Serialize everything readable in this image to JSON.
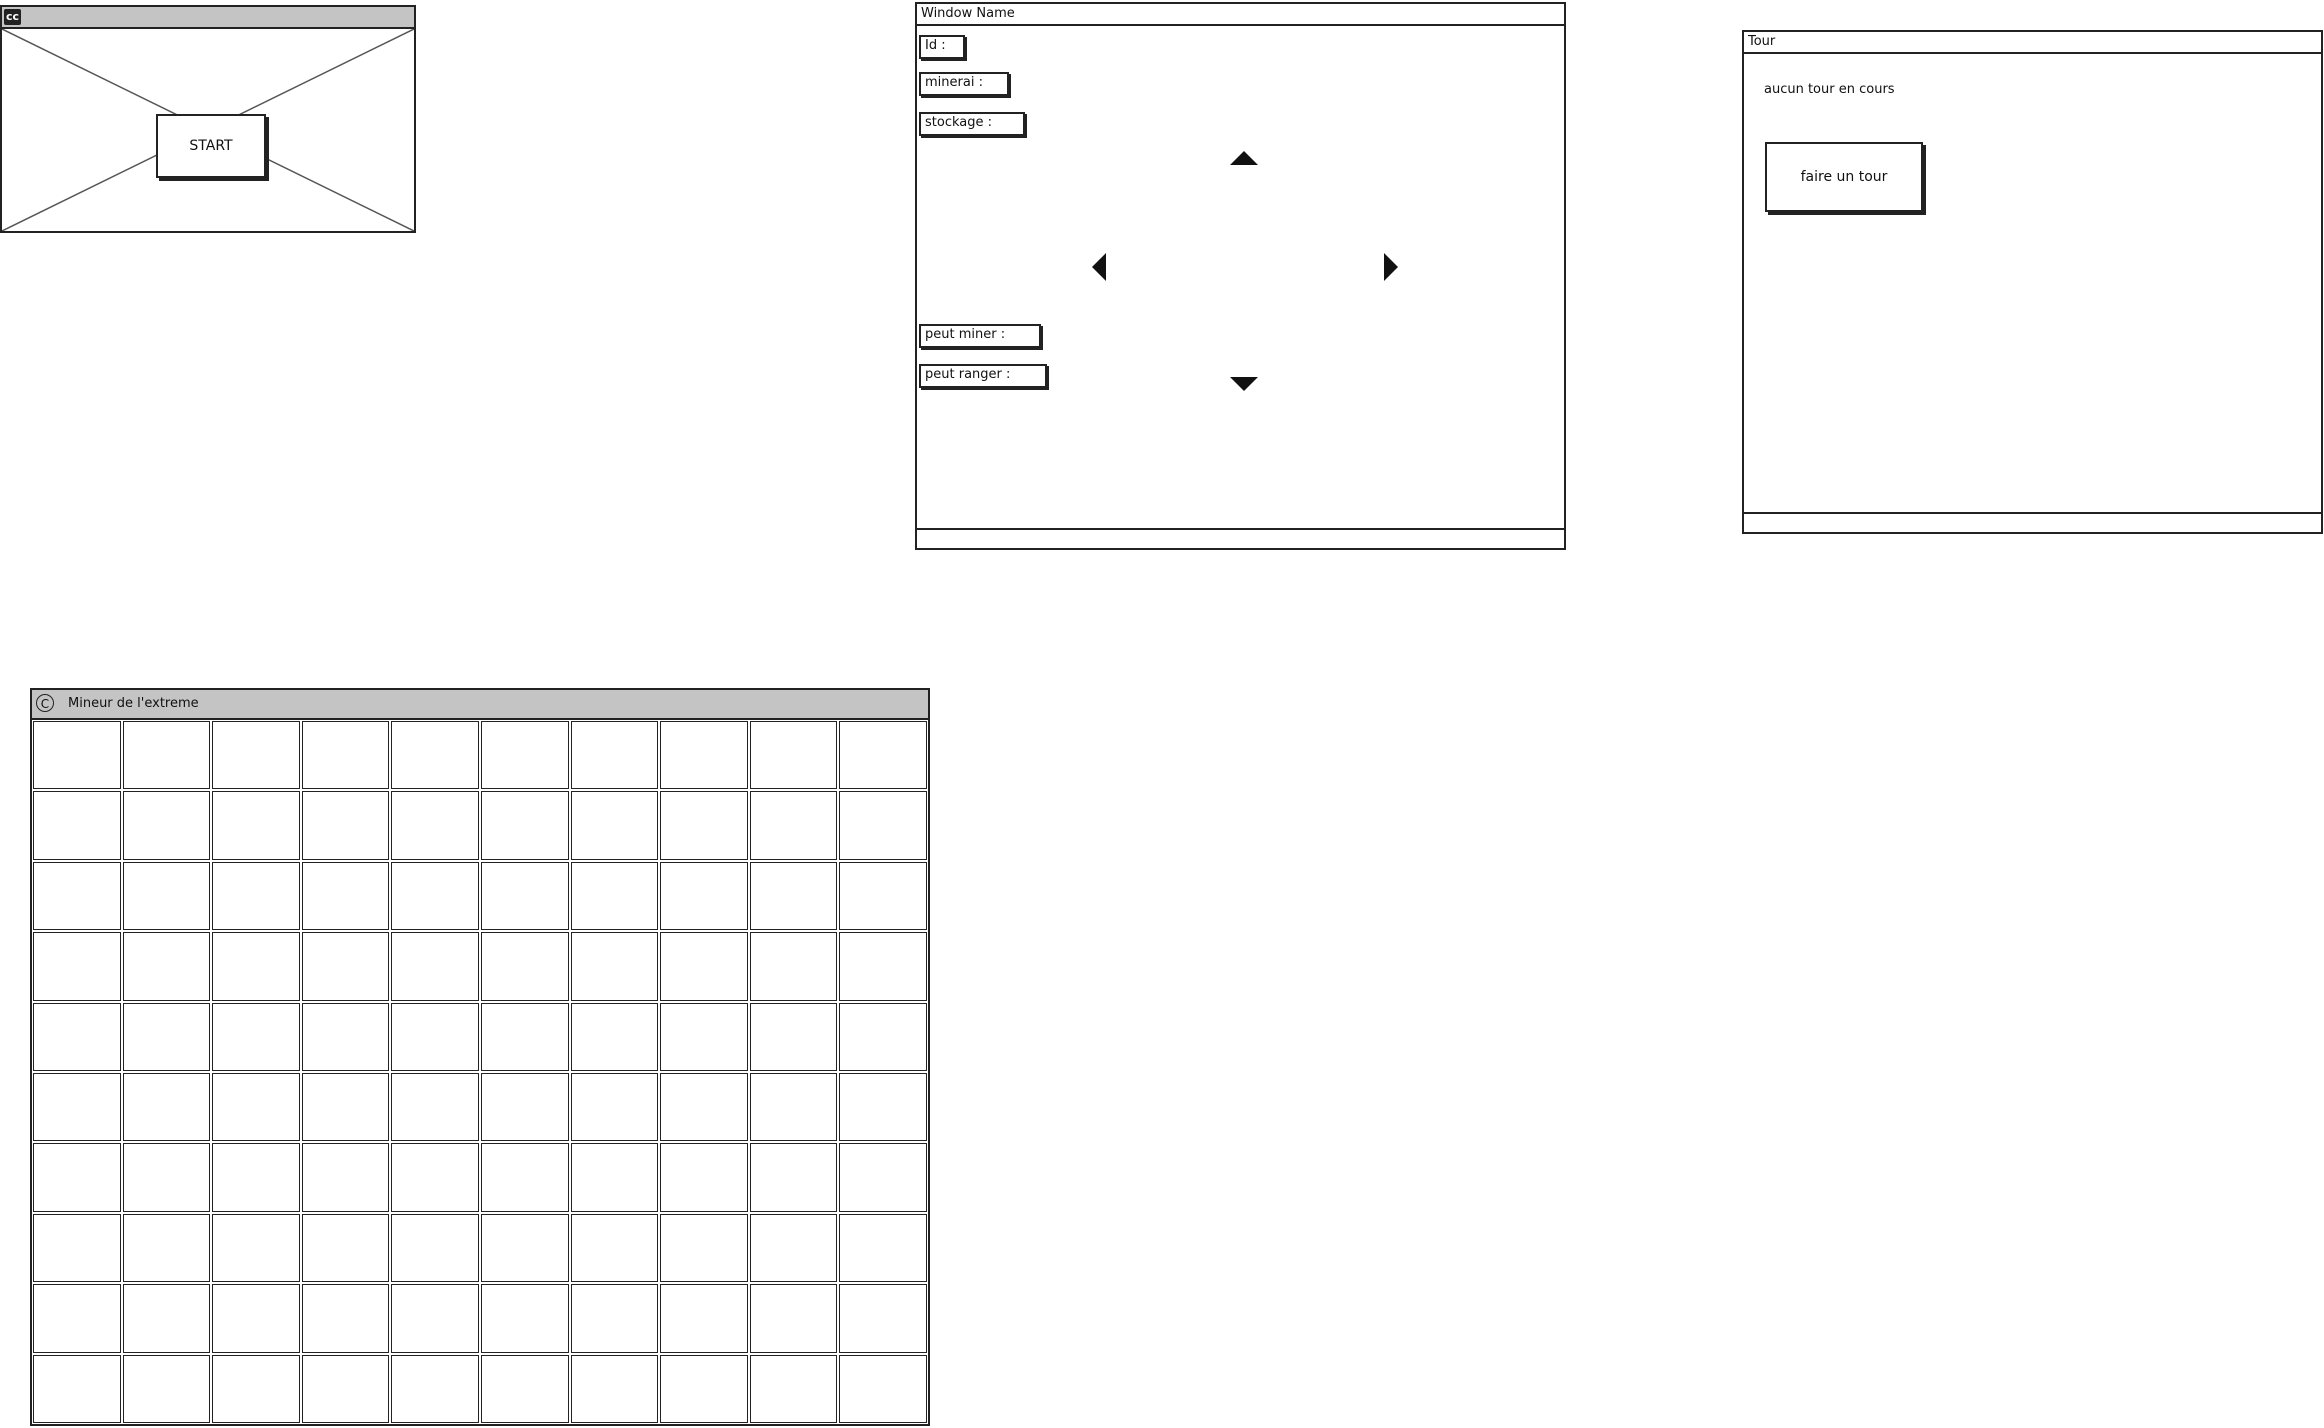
{
  "start_window": {
    "badge": "cc",
    "start_button_label": "START"
  },
  "robot_window": {
    "title": "Window Name",
    "fields": {
      "id": "Id :",
      "minerai": "minerai :",
      "stockage": "stockage :",
      "peut_miner": "peut miner :",
      "peut_ranger": "peut ranger :"
    },
    "arrows": [
      "arrow-up-icon",
      "arrow-left-icon",
      "arrow-right-icon",
      "arrow-down-icon"
    ]
  },
  "tour_window": {
    "title": "Tour",
    "status_text": "aucun tour en cours",
    "button_label": "faire un tour"
  },
  "game_window": {
    "title": "Mineur de l'extreme",
    "icon": "copyright-icon",
    "grid_rows": 10,
    "grid_cols": 10
  }
}
